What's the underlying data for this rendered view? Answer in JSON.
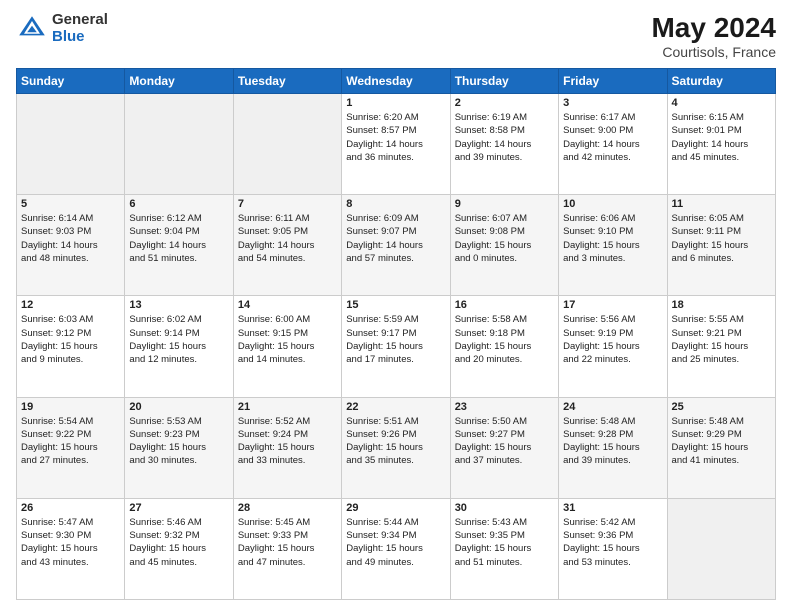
{
  "header": {
    "logo_general": "General",
    "logo_blue": "Blue",
    "month": "May 2024",
    "location": "Courtisols, France"
  },
  "weekdays": [
    "Sunday",
    "Monday",
    "Tuesday",
    "Wednesday",
    "Thursday",
    "Friday",
    "Saturday"
  ],
  "weeks": [
    [
      {
        "day": "",
        "info": ""
      },
      {
        "day": "",
        "info": ""
      },
      {
        "day": "",
        "info": ""
      },
      {
        "day": "1",
        "info": "Sunrise: 6:20 AM\nSunset: 8:57 PM\nDaylight: 14 hours\nand 36 minutes."
      },
      {
        "day": "2",
        "info": "Sunrise: 6:19 AM\nSunset: 8:58 PM\nDaylight: 14 hours\nand 39 minutes."
      },
      {
        "day": "3",
        "info": "Sunrise: 6:17 AM\nSunset: 9:00 PM\nDaylight: 14 hours\nand 42 minutes."
      },
      {
        "day": "4",
        "info": "Sunrise: 6:15 AM\nSunset: 9:01 PM\nDaylight: 14 hours\nand 45 minutes."
      }
    ],
    [
      {
        "day": "5",
        "info": "Sunrise: 6:14 AM\nSunset: 9:03 PM\nDaylight: 14 hours\nand 48 minutes."
      },
      {
        "day": "6",
        "info": "Sunrise: 6:12 AM\nSunset: 9:04 PM\nDaylight: 14 hours\nand 51 minutes."
      },
      {
        "day": "7",
        "info": "Sunrise: 6:11 AM\nSunset: 9:05 PM\nDaylight: 14 hours\nand 54 minutes."
      },
      {
        "day": "8",
        "info": "Sunrise: 6:09 AM\nSunset: 9:07 PM\nDaylight: 14 hours\nand 57 minutes."
      },
      {
        "day": "9",
        "info": "Sunrise: 6:07 AM\nSunset: 9:08 PM\nDaylight: 15 hours\nand 0 minutes."
      },
      {
        "day": "10",
        "info": "Sunrise: 6:06 AM\nSunset: 9:10 PM\nDaylight: 15 hours\nand 3 minutes."
      },
      {
        "day": "11",
        "info": "Sunrise: 6:05 AM\nSunset: 9:11 PM\nDaylight: 15 hours\nand 6 minutes."
      }
    ],
    [
      {
        "day": "12",
        "info": "Sunrise: 6:03 AM\nSunset: 9:12 PM\nDaylight: 15 hours\nand 9 minutes."
      },
      {
        "day": "13",
        "info": "Sunrise: 6:02 AM\nSunset: 9:14 PM\nDaylight: 15 hours\nand 12 minutes."
      },
      {
        "day": "14",
        "info": "Sunrise: 6:00 AM\nSunset: 9:15 PM\nDaylight: 15 hours\nand 14 minutes."
      },
      {
        "day": "15",
        "info": "Sunrise: 5:59 AM\nSunset: 9:17 PM\nDaylight: 15 hours\nand 17 minutes."
      },
      {
        "day": "16",
        "info": "Sunrise: 5:58 AM\nSunset: 9:18 PM\nDaylight: 15 hours\nand 20 minutes."
      },
      {
        "day": "17",
        "info": "Sunrise: 5:56 AM\nSunset: 9:19 PM\nDaylight: 15 hours\nand 22 minutes."
      },
      {
        "day": "18",
        "info": "Sunrise: 5:55 AM\nSunset: 9:21 PM\nDaylight: 15 hours\nand 25 minutes."
      }
    ],
    [
      {
        "day": "19",
        "info": "Sunrise: 5:54 AM\nSunset: 9:22 PM\nDaylight: 15 hours\nand 27 minutes."
      },
      {
        "day": "20",
        "info": "Sunrise: 5:53 AM\nSunset: 9:23 PM\nDaylight: 15 hours\nand 30 minutes."
      },
      {
        "day": "21",
        "info": "Sunrise: 5:52 AM\nSunset: 9:24 PM\nDaylight: 15 hours\nand 33 minutes."
      },
      {
        "day": "22",
        "info": "Sunrise: 5:51 AM\nSunset: 9:26 PM\nDaylight: 15 hours\nand 35 minutes."
      },
      {
        "day": "23",
        "info": "Sunrise: 5:50 AM\nSunset: 9:27 PM\nDaylight: 15 hours\nand 37 minutes."
      },
      {
        "day": "24",
        "info": "Sunrise: 5:48 AM\nSunset: 9:28 PM\nDaylight: 15 hours\nand 39 minutes."
      },
      {
        "day": "25",
        "info": "Sunrise: 5:48 AM\nSunset: 9:29 PM\nDaylight: 15 hours\nand 41 minutes."
      }
    ],
    [
      {
        "day": "26",
        "info": "Sunrise: 5:47 AM\nSunset: 9:30 PM\nDaylight: 15 hours\nand 43 minutes."
      },
      {
        "day": "27",
        "info": "Sunrise: 5:46 AM\nSunset: 9:32 PM\nDaylight: 15 hours\nand 45 minutes."
      },
      {
        "day": "28",
        "info": "Sunrise: 5:45 AM\nSunset: 9:33 PM\nDaylight: 15 hours\nand 47 minutes."
      },
      {
        "day": "29",
        "info": "Sunrise: 5:44 AM\nSunset: 9:34 PM\nDaylight: 15 hours\nand 49 minutes."
      },
      {
        "day": "30",
        "info": "Sunrise: 5:43 AM\nSunset: 9:35 PM\nDaylight: 15 hours\nand 51 minutes."
      },
      {
        "day": "31",
        "info": "Sunrise: 5:42 AM\nSunset: 9:36 PM\nDaylight: 15 hours\nand 53 minutes."
      },
      {
        "day": "",
        "info": ""
      }
    ]
  ]
}
